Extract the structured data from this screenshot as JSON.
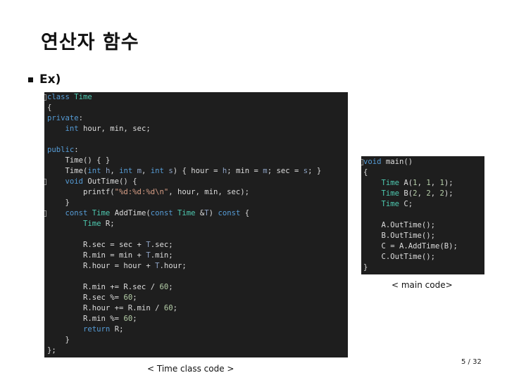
{
  "slide": {
    "title": "연산자 함수",
    "bullet": "Ex)",
    "page_indicator": "5 / 32"
  },
  "main_code": {
    "caption": "< Time class code >",
    "lines": [
      [
        [
          "kw",
          "class"
        ],
        [
          "pl",
          " "
        ],
        [
          "ty",
          "Time"
        ]
      ],
      [
        [
          "pl",
          "{"
        ]
      ],
      [
        [
          "kw",
          "private"
        ],
        [
          "pl",
          ":"
        ]
      ],
      [
        [
          "pl",
          "    "
        ],
        [
          "kw",
          "int"
        ],
        [
          "pl",
          " hour, min, sec;"
        ]
      ],
      [],
      [
        [
          "kw",
          "public"
        ],
        [
          "pl",
          ":"
        ]
      ],
      [
        [
          "pl",
          "    Time() { }"
        ]
      ],
      [
        [
          "pl",
          "    Time("
        ],
        [
          "kw",
          "int"
        ],
        [
          "pl",
          " "
        ],
        [
          "pa",
          "h"
        ],
        [
          "pl",
          ", "
        ],
        [
          "kw",
          "int"
        ],
        [
          "pl",
          " "
        ],
        [
          "pa",
          "m"
        ],
        [
          "pl",
          ", "
        ],
        [
          "kw",
          "int"
        ],
        [
          "pl",
          " "
        ],
        [
          "pa",
          "s"
        ],
        [
          "pl",
          ") { hour = "
        ],
        [
          "pa",
          "h"
        ],
        [
          "pl",
          "; min = "
        ],
        [
          "pa",
          "m"
        ],
        [
          "pl",
          "; sec = "
        ],
        [
          "pa",
          "s"
        ],
        [
          "pl",
          "; }"
        ]
      ],
      [
        [
          "pl",
          "    "
        ],
        [
          "kw",
          "void"
        ],
        [
          "pl",
          " OutTime() {"
        ]
      ],
      [
        [
          "pl",
          "        printf("
        ],
        [
          "st",
          "\"%d:%d:%d\\n\""
        ],
        [
          "pl",
          ", hour, min, sec);"
        ]
      ],
      [
        [
          "pl",
          "    }"
        ]
      ],
      [
        [
          "pl",
          "    "
        ],
        [
          "kw",
          "const"
        ],
        [
          "pl",
          " "
        ],
        [
          "ty",
          "Time"
        ],
        [
          "pl",
          " AddTime("
        ],
        [
          "kw",
          "const"
        ],
        [
          "pl",
          " "
        ],
        [
          "ty",
          "Time"
        ],
        [
          "pl",
          " &"
        ],
        [
          "pa",
          "T"
        ],
        [
          "pl",
          ") "
        ],
        [
          "kw",
          "const"
        ],
        [
          "pl",
          " {"
        ]
      ],
      [
        [
          "pl",
          "        "
        ],
        [
          "ty",
          "Time"
        ],
        [
          "pl",
          " R;"
        ]
      ],
      [],
      [
        [
          "pl",
          "        R.sec = sec + "
        ],
        [
          "pa",
          "T"
        ],
        [
          "pl",
          ".sec;"
        ]
      ],
      [
        [
          "pl",
          "        R.min = min + "
        ],
        [
          "pa",
          "T"
        ],
        [
          "pl",
          ".min;"
        ]
      ],
      [
        [
          "pl",
          "        R.hour = hour + "
        ],
        [
          "pa",
          "T"
        ],
        [
          "pl",
          ".hour;"
        ]
      ],
      [],
      [
        [
          "pl",
          "        R.min += R.sec / "
        ],
        [
          "nu",
          "60"
        ],
        [
          "pl",
          ";"
        ]
      ],
      [
        [
          "pl",
          "        R.sec %= "
        ],
        [
          "nu",
          "60"
        ],
        [
          "pl",
          ";"
        ]
      ],
      [
        [
          "pl",
          "        R.hour += R.min / "
        ],
        [
          "nu",
          "60"
        ],
        [
          "pl",
          ";"
        ]
      ],
      [
        [
          "pl",
          "        R.min %= "
        ],
        [
          "nu",
          "60"
        ],
        [
          "pl",
          ";"
        ]
      ],
      [
        [
          "pl",
          "        "
        ],
        [
          "kw",
          "return"
        ],
        [
          "pl",
          " R;"
        ]
      ],
      [
        [
          "pl",
          "    }"
        ]
      ],
      [
        [
          "pl",
          "};"
        ]
      ]
    ]
  },
  "side_code": {
    "caption": "< main code>",
    "lines": [
      [
        [
          "kw",
          "void"
        ],
        [
          "pl",
          " main()"
        ]
      ],
      [
        [
          "pl",
          "{"
        ]
      ],
      [
        [
          "pl",
          "    "
        ],
        [
          "ty",
          "Time"
        ],
        [
          "pl",
          " A("
        ],
        [
          "nu",
          "1"
        ],
        [
          "pl",
          ", "
        ],
        [
          "nu",
          "1"
        ],
        [
          "pl",
          ", "
        ],
        [
          "nu",
          "1"
        ],
        [
          "pl",
          ");"
        ]
      ],
      [
        [
          "pl",
          "    "
        ],
        [
          "ty",
          "Time"
        ],
        [
          "pl",
          " B("
        ],
        [
          "nu",
          "2"
        ],
        [
          "pl",
          ", "
        ],
        [
          "nu",
          "2"
        ],
        [
          "pl",
          ", "
        ],
        [
          "nu",
          "2"
        ],
        [
          "pl",
          ");"
        ]
      ],
      [
        [
          "pl",
          "    "
        ],
        [
          "ty",
          "Time"
        ],
        [
          "pl",
          " C;"
        ]
      ],
      [],
      [
        [
          "pl",
          "    A.OutTime();"
        ]
      ],
      [
        [
          "pl",
          "    B.OutTime();"
        ]
      ],
      [
        [
          "pl",
          "    C = A.AddTime(B);"
        ]
      ],
      [
        [
          "pl",
          "    C.OutTime();"
        ]
      ],
      [
        [
          "pl",
          "}"
        ]
      ]
    ]
  }
}
